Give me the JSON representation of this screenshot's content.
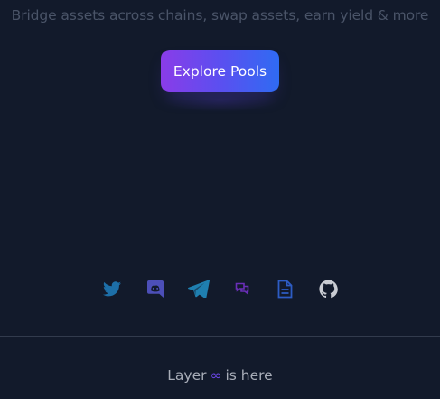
{
  "hero": {
    "tagline": "Bridge assets across chains, swap assets, earn yield & more",
    "cta_label": "Explore Pools"
  },
  "socials": [
    {
      "name": "twitter-icon",
      "color": "#1d6fa8"
    },
    {
      "name": "discord-icon",
      "color": "#4c4fb8"
    },
    {
      "name": "telegram-icon",
      "color": "#1f7fb0"
    },
    {
      "name": "forum-icon",
      "color": "#6a2fb8"
    },
    {
      "name": "docs-icon",
      "color": "#2d5cc4"
    },
    {
      "name": "github-icon",
      "color": "#c9ccd3"
    }
  ],
  "footer": {
    "prefix": "Layer",
    "symbol": "∞",
    "suffix": "is here",
    "symbol_color": "#6b47e8"
  }
}
